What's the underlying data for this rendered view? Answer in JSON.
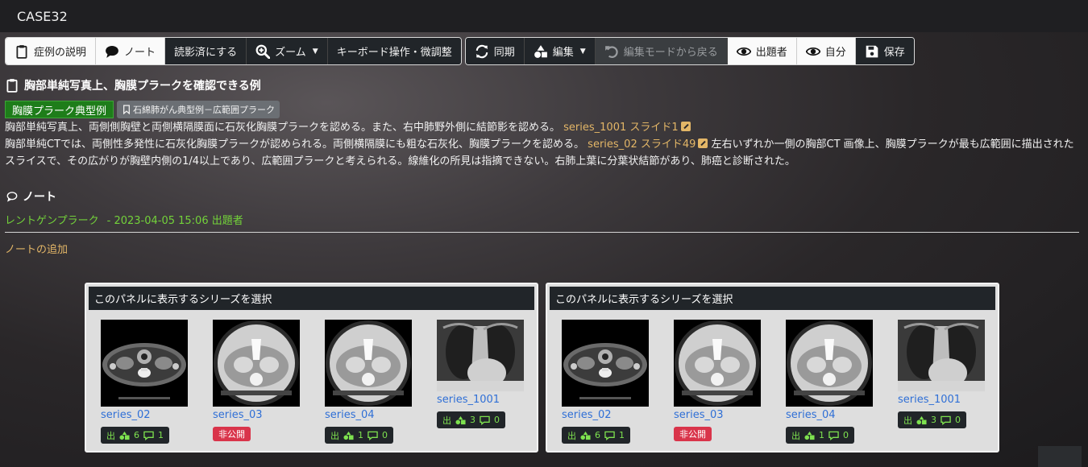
{
  "app": {
    "case_title": "CASE32"
  },
  "toolbar": {
    "case_description": "症例の説明",
    "note": "ノート",
    "mark_read": "読影済にする",
    "zoom": "ズーム",
    "keyboard": "キーボード操作・微調整",
    "sync": "同期",
    "edit": "編集",
    "exit_edit": "編集モードから戻る",
    "examiner": "出題者",
    "self": "自分",
    "save": "保存"
  },
  "case": {
    "heading": "胸部単純写真上、胸膜プラークを確認できる例",
    "tags": {
      "primary": "胸膜プラーク典型例",
      "secondary": "石綿肺がん典型例－広範囲プラーク"
    },
    "desc1": "胸部単純写真上、両側側胸壁と両側横隔膜面に石灰化胸膜プラークを認める。また、右中肺野外側に結節影を認める。",
    "link1": "series_1001 スライド1",
    "desc2a": "胸部単純CTでは、両側性多発性に石灰化胸膜プラークが認められる。両側横隔膜にも粗な石灰化、胸膜プラークを認める。",
    "link2": "series_02 スライド49",
    "desc2b": "左右いずれか一側の胸部CT 画像上、胸膜プラークが最も広範囲に描出されたスライスで、その広がりが胸壁内側の1/4以上であり、広範囲プラークと考えられる。線維化の所見は指摘できない。右肺上葉に分葉状結節があり、肺癌と診断された。"
  },
  "notes": {
    "heading": "ノート",
    "entry_title": "レントゲンプラーク",
    "entry_meta": "- 2023-04-05 15:06  出題者",
    "add": "ノートの追加"
  },
  "panels": [
    {
      "title": "このパネルに表示するシリーズを選択",
      "series": [
        {
          "name": "series_02",
          "type": "ct-neck",
          "status": "counts",
          "out": "出",
          "shapes": "6",
          "comments": "1"
        },
        {
          "name": "series_03",
          "type": "ct-round",
          "status": "private",
          "label": "非公開"
        },
        {
          "name": "series_04",
          "type": "ct-round",
          "status": "counts",
          "out": "出",
          "shapes": "1",
          "comments": "0"
        },
        {
          "name": "series_1001",
          "type": "xray",
          "status": "counts",
          "out": "出",
          "shapes": "3",
          "comments": "0"
        }
      ]
    },
    {
      "title": "このパネルに表示するシリーズを選択",
      "series": [
        {
          "name": "series_02",
          "type": "ct-neck",
          "status": "counts",
          "out": "出",
          "shapes": "6",
          "comments": "1"
        },
        {
          "name": "series_03",
          "type": "ct-round",
          "status": "private",
          "label": "非公開"
        },
        {
          "name": "series_04",
          "type": "ct-round",
          "status": "counts",
          "out": "出",
          "shapes": "1",
          "comments": "0"
        },
        {
          "name": "series_1001",
          "type": "xray",
          "status": "counts",
          "out": "出",
          "shapes": "3",
          "comments": "0"
        }
      ]
    }
  ]
}
